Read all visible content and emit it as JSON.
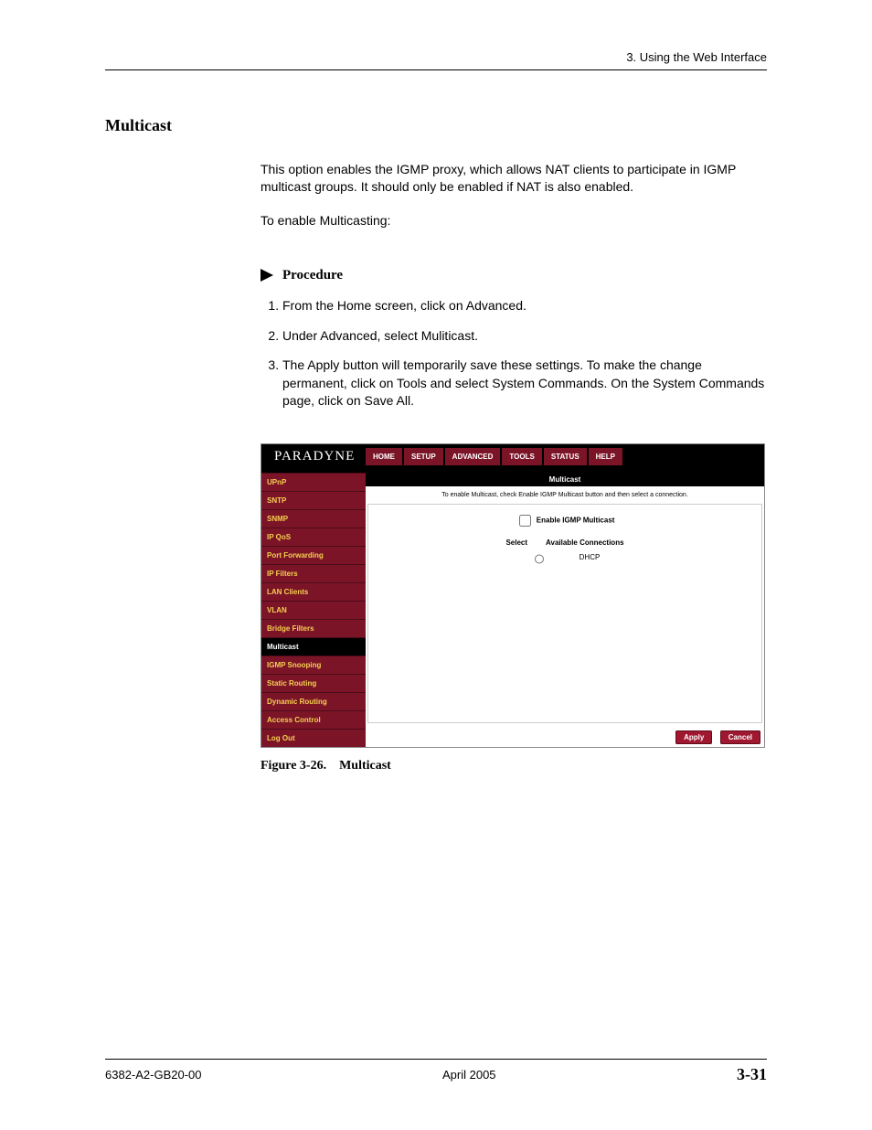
{
  "header": {
    "chapter": "3. Using the Web Interface"
  },
  "section": {
    "title": "Multicast"
  },
  "paragraphs": {
    "p1": "This option enables the IGMP proxy, which allows NAT clients to participate in IGMP multicast groups. It should only be enabled if NAT is also enabled.",
    "p2": "To enable Multicasting:"
  },
  "procedure": {
    "label": "Procedure",
    "steps": [
      "From the Home screen, click on Advanced.",
      "Under Advanced, select Muliticast.",
      "The Apply button will temporarily save these settings. To make the change permanent, click on Tools and select System Commands. On the System Commands page, click on Save All."
    ]
  },
  "figure": {
    "caption": "Figure 3-26. Multicast",
    "logo": "PARADYNE",
    "tabs": [
      "HOME",
      "SETUP",
      "ADVANCED",
      "TOOLS",
      "STATUS",
      "HELP"
    ],
    "sidebar": [
      "UPnP",
      "SNTP",
      "SNMP",
      "IP QoS",
      "Port Forwarding",
      "IP Filters",
      "LAN Clients",
      "VLAN",
      "Bridge Filters",
      "Multicast",
      "IGMP Snooping",
      "Static Routing",
      "Dynamic Routing",
      "Access Control",
      "Log Out"
    ],
    "sidebar_active": "Multicast",
    "content": {
      "title": "Multicast",
      "subtitle": "To enable Multicast, check Enable IGMP Multicast button and then select a connection.",
      "enable_label": "Enable IGMP Multicast",
      "col_select": "Select",
      "col_avail": "Available Connections",
      "row_conn": "DHCP",
      "btn_apply": "Apply",
      "btn_cancel": "Cancel"
    }
  },
  "footer": {
    "docnum": "6382-A2-GB20-00",
    "date": "April 2005",
    "page": "3-31"
  }
}
